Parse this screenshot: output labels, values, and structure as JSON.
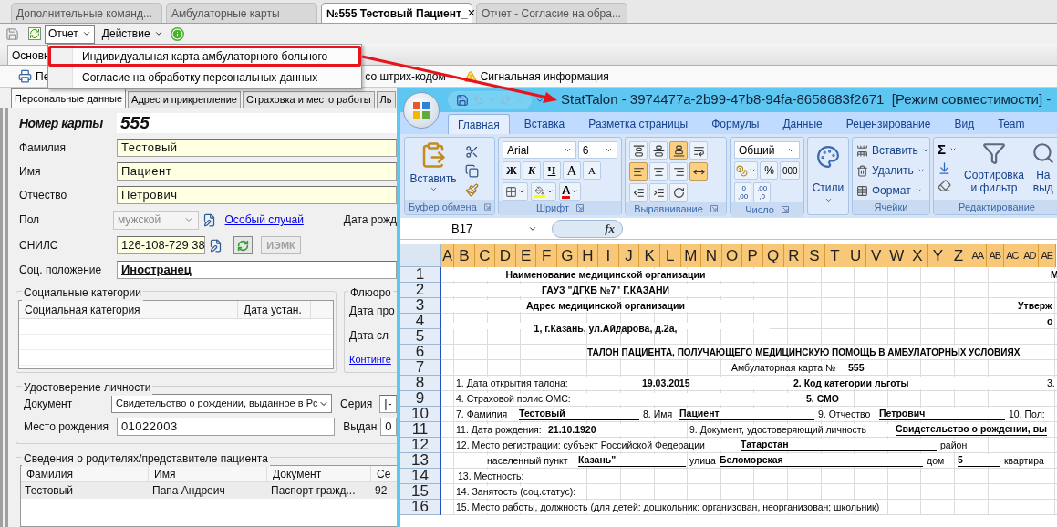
{
  "doc_tabs": [
    {
      "label": "Дополнительные  команд...",
      "selected": false,
      "closable": false
    },
    {
      "label": "Амбулаторные карты",
      "selected": false,
      "closable": false
    },
    {
      "label": "№555 Тестовый Пациент_",
      "selected": true,
      "closable": true
    },
    {
      "label": "Отчет  - Согласие на обра...",
      "selected": false,
      "closable": false
    }
  ],
  "close_glyph": "×",
  "menus": [
    {
      "label": "Отчет",
      "open": true
    },
    {
      "label": "Действие",
      "open": false
    }
  ],
  "report_menu": [
    {
      "label": "Индивидуальная карта амбулаторного больного",
      "highlighted": true
    },
    {
      "label": "Согласие на обработку персональных данных",
      "highlighted": false
    }
  ],
  "section_tab": "Основн",
  "actions": [
    {
      "kind": "print",
      "label": "Пе"
    },
    {
      "kind": "plain",
      "label": "со штрих-кодом"
    },
    {
      "kind": "warning",
      "label": "Сигнальная информация"
    }
  ],
  "form_tabs": [
    {
      "label": "Персональные данные",
      "selected": true
    },
    {
      "label": "Адрес и прикрепление",
      "selected": false
    },
    {
      "label": "Страховка и место работы",
      "selected": false
    },
    {
      "label": "Ль",
      "selected": false
    }
  ],
  "card": {
    "label": "Номер карты",
    "value": "555"
  },
  "name_fields": [
    {
      "label": "Фамилия",
      "value": "Тестовый"
    },
    {
      "label": "Имя",
      "value": "Пациент"
    },
    {
      "label": "Отчество",
      "value": "Петрович"
    }
  ],
  "sex": {
    "label": "Пол",
    "value": "мужской",
    "disabled": true
  },
  "special_case_link": "Особый случай",
  "birth_date_label": "Дата рожд",
  "snils": {
    "label": "СНИЛС",
    "value": "126-108-729 38"
  },
  "iemk_button": {
    "label": "ИЭМК",
    "disabled": true
  },
  "social_status": {
    "label": "Соц. положение",
    "value": "Иностранец"
  },
  "social_categories": {
    "title": "Социальные категории",
    "columns": [
      "Социальная категория",
      "Дата устан."
    ]
  },
  "fluoro": {
    "title": "Флюоро",
    "labels": [
      "Дата про",
      "Дата сл"
    ],
    "link": "Континге"
  },
  "identity": {
    "title": "Удостоверение личности",
    "document": {
      "label": "Документ",
      "value": "Свидетельство о рождении, выданное в Рс"
    },
    "series": {
      "label": "Серия",
      "value": "|-"
    },
    "birthplace": {
      "label": "Место рождения",
      "value": "01022003"
    },
    "issued": {
      "label": "Выдан",
      "value": "0"
    }
  },
  "parents": {
    "title": "Сведения о родителях/представителе пациента",
    "columns": [
      "Фамилия",
      "Имя",
      "Документ",
      "Се"
    ],
    "rows": [
      [
        "Тестовый",
        "Папа Андреич",
        "Паспорт гражд...",
        "92"
      ]
    ]
  },
  "excel": {
    "title": "StatTalon - 3974477a-2b99-47b8-94fa-8658683f2671  [Режим совместимости] -",
    "ribbon_tabs": [
      {
        "label": "Главная",
        "selected": true
      },
      {
        "label": "Вставка",
        "selected": false
      },
      {
        "label": "Разметка страницы",
        "selected": false
      },
      {
        "label": "Формулы",
        "selected": false
      },
      {
        "label": "Данные",
        "selected": false
      },
      {
        "label": "Рецензирование",
        "selected": false
      },
      {
        "label": "Вид",
        "selected": false
      },
      {
        "label": "Team",
        "selected": false
      }
    ],
    "clipboard": {
      "paste": "Вставить",
      "group": "Буфер обмена"
    },
    "font": {
      "name": "Arial",
      "size": "6",
      "styles": [
        "Ж",
        "К",
        "Ч"
      ],
      "grow": "A",
      "shrink": "A",
      "color_letter": "A",
      "group": "Шрифт"
    },
    "alignment": {
      "group": "Выравнивание",
      "buttons": [
        {
          "kind": "top",
          "active": false
        },
        {
          "kind": "middle",
          "active": false
        },
        {
          "kind": "bottom",
          "active": true
        },
        {
          "kind": "wrap",
          "active": false
        },
        {
          "kind": "left",
          "active": true
        },
        {
          "kind": "center",
          "active": false
        },
        {
          "kind": "right",
          "active": false
        },
        {
          "kind": "merge",
          "active": true
        },
        {
          "kind": "outdent",
          "active": false
        },
        {
          "kind": "indent",
          "active": false
        },
        {
          "kind": "orientation",
          "active": false
        }
      ]
    },
    "number": {
      "format": "Общий",
      "percent": "%",
      "thousands": "000",
      "decimals": [
        ",0\n,00",
        ",00\n,0"
      ],
      "group": "Число"
    },
    "styles": "Стили",
    "cells": {
      "buttons": [
        "Вставить",
        "Удалить",
        "Формат"
      ],
      "group": "Ячейки"
    },
    "editing": {
      "sum": "Σ",
      "sort": "Сортировка\nи фильтр",
      "find": "На\nвыд",
      "group": "Редактирование"
    },
    "name_box": "B17",
    "fx": "fx",
    "header_letters": [
      "A",
      "B",
      "C",
      "D",
      "E",
      "F",
      "G",
      "H",
      "I",
      "J",
      "K",
      "L",
      "M",
      "N",
      "O",
      "P",
      "Q",
      "R",
      "S",
      "T",
      "U",
      "V",
      "W",
      "X",
      "Y",
      "Z",
      "AA",
      "AB",
      "AC",
      "AD",
      "AE"
    ],
    "sheet_rows": [
      {
        "number": "1",
        "cells": [
          {
            "kind": "title",
            "text": "Наименование медицинской организации"
          },
          {
            "kind": "strong",
            "text": "М"
          }
        ]
      },
      {
        "number": "2",
        "cells": [
          {
            "kind": "title",
            "text": "ГАУЗ \"ДГКБ №7\" Г.КАЗАНИ"
          }
        ]
      },
      {
        "number": "3",
        "cells": [
          {
            "kind": "title",
            "text": "Адрес медицинской организации"
          },
          {
            "kind": "strong",
            "text": "Утверж"
          }
        ]
      },
      {
        "number": "4",
        "cells": [
          {
            "kind": "title",
            "text": "1, г.Казань, ул.Айдарова, д.2а,"
          },
          {
            "kind": "strong",
            "text": "о"
          }
        ]
      },
      {
        "number": "5",
        "cells": []
      },
      {
        "number": "6",
        "cells": [
          {
            "kind": "strong",
            "text": "ТАЛОН ПАЦИЕНТА, ПОЛУЧАЮЩЕГО МЕДИЦИНСКУЮ ПОМОЩЬ В АМБУЛАТОРНЫХ УСЛОВИЯХ"
          }
        ]
      },
      {
        "number": "7",
        "cells": [
          {
            "kind": "label",
            "text": "Амбулаторная карта №"
          },
          {
            "kind": "strong",
            "text": "555"
          }
        ]
      },
      {
        "number": "8",
        "cells": [
          {
            "kind": "label",
            "text": "1. Дата открытия талона:"
          },
          {
            "kind": "strong",
            "text": "19.03.2015"
          },
          {
            "kind": "strong",
            "text": "2. Код категории льготы"
          },
          {
            "kind": "label",
            "text": "3."
          }
        ]
      },
      {
        "number": "9",
        "cells": [
          {
            "kind": "label",
            "text": "4. Страховой полис ОМС:"
          },
          {
            "kind": "strong",
            "text": "5. СМО"
          }
        ]
      },
      {
        "number": "10",
        "cells": [
          {
            "kind": "label",
            "text": "7. Фамилия"
          },
          {
            "kind": "value",
            "text": "Тестовый"
          },
          {
            "kind": "label",
            "text": "8. Имя"
          },
          {
            "kind": "value",
            "text": "Пациент"
          },
          {
            "kind": "label",
            "text": "9. Отчество"
          },
          {
            "kind": "value",
            "text": "Петрович"
          },
          {
            "kind": "label",
            "text": "10. Пол:"
          }
        ]
      },
      {
        "number": "11",
        "cells": [
          {
            "kind": "label",
            "text": "11. Дата рождения:"
          },
          {
            "kind": "strong",
            "text": "21.10.1920"
          },
          {
            "kind": "label",
            "text": "9. Документ, удостоверяющий личность"
          },
          {
            "kind": "value",
            "text": "Свидетельство о рождении, вы"
          }
        ]
      },
      {
        "number": "12",
        "cells": [
          {
            "kind": "label",
            "text": "12. Место регистрации: субъект Российской Федерации"
          },
          {
            "kind": "value",
            "text": "Татарстан"
          },
          {
            "kind": "label",
            "text": "район"
          }
        ]
      },
      {
        "number": "13",
        "cells": [
          {
            "kind": "label",
            "text": "населенный пункт"
          },
          {
            "kind": "value",
            "text": "Казань\""
          },
          {
            "kind": "label",
            "text": "улица"
          },
          {
            "kind": "value",
            "text": "Беломорская"
          },
          {
            "kind": "label",
            "text": "дом"
          },
          {
            "kind": "value",
            "text": "5"
          },
          {
            "kind": "label",
            "text": "квартира"
          }
        ]
      },
      {
        "number": "14",
        "cells": [
          {
            "kind": "label",
            "text": "13. Местность:"
          }
        ]
      },
      {
        "number": "15",
        "cells": [
          {
            "kind": "label",
            "text": "14. Занятость (соц.статус):"
          }
        ]
      },
      {
        "number": "16",
        "cells": [
          {
            "kind": "label",
            "text": "15. Место работы, должность (для детей: дошкольник: организован, неорганизован; школьник)"
          }
        ]
      }
    ]
  }
}
